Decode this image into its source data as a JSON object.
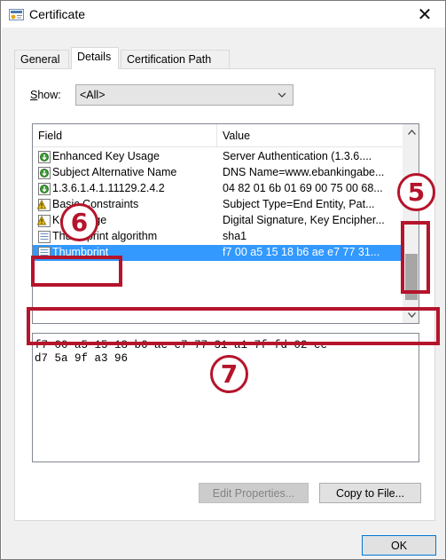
{
  "window": {
    "title": "Certificate",
    "icon": "certificate-icon",
    "close_glyph": "✕"
  },
  "tabs": [
    {
      "label": "General"
    },
    {
      "label": "Details"
    },
    {
      "label": "Certification Path"
    }
  ],
  "show": {
    "label_prefix": "S",
    "label_rest": "how:",
    "selected": "<All>"
  },
  "list": {
    "columns": [
      "Field",
      "Value"
    ],
    "rows": [
      {
        "field": "Enhanced Key Usage",
        "value": "Server Authentication (1.3.6....",
        "icon": "extension-icon"
      },
      {
        "field": "Subject Alternative Name",
        "value": "DNS Name=www.ebankingabe...",
        "icon": "extension-icon"
      },
      {
        "field": "1.3.6.1.4.1.11129.2.4.2",
        "value": "04 82 01 6b 01 69 00 75 00 68...",
        "icon": "extension-icon"
      },
      {
        "field": "Basic Constraints",
        "value": "Subject Type=End Entity, Pat...",
        "icon": "warning-extension-icon"
      },
      {
        "field": "Key Usage",
        "value": "Digital Signature, Key Encipher...",
        "icon": "warning-extension-icon"
      },
      {
        "field": "Thumbprint algorithm",
        "value": "sha1",
        "icon": "property-icon"
      },
      {
        "field": "Thumbprint",
        "value": "f7 00 a5 15 18 b6 ae e7 77 31...",
        "icon": "property-icon",
        "selected": true
      }
    ]
  },
  "detail": {
    "text": "f7 00 a5 15 18 b6 ae e7 77 31 a1 7f fd 02 ee\nd7 5a 9f a3 96"
  },
  "buttons": {
    "edit_properties": "Edit Properties...",
    "copy_to_file": "Copy to File...",
    "ok": "OK"
  },
  "callouts": {
    "five": "5",
    "six": "6",
    "seven": "7",
    "color": "#b5142b"
  },
  "colors": {
    "selection": "#3399ff",
    "ok_border": "#0078d7"
  }
}
